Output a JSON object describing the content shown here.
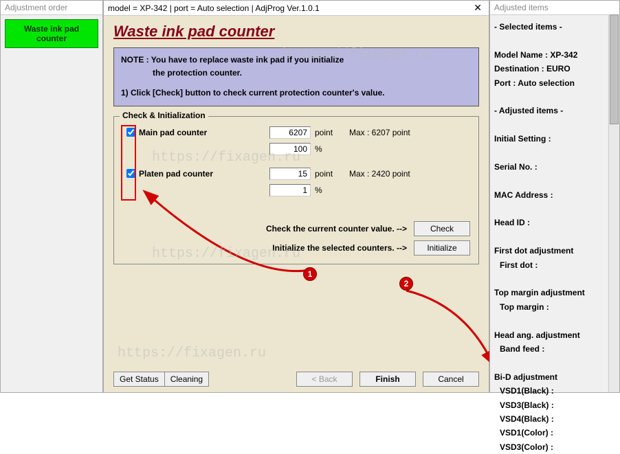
{
  "left": {
    "title": "Adjustment order",
    "button": "Waste ink pad counter"
  },
  "center": {
    "header": "model = XP-342 | port = Auto selection | AdjProg Ver.1.0.1",
    "close": "✕",
    "heading": "Waste ink pad counter",
    "note_l1": "NOTE : You have to replace waste ink pad if you initialize",
    "note_l2": "the protection counter.",
    "note_l3": "1) Click [Check] button to check current protection counter's value.",
    "fieldset_legend": "Check & Initialization",
    "main_pad": {
      "label": "Main pad counter",
      "value": "6207",
      "unit": "point",
      "max": "Max : 6207 point",
      "pct": "100",
      "pct_unit": "%"
    },
    "platen_pad": {
      "label": "Platen pad counter",
      "value": "15",
      "unit": "point",
      "max": "Max : 2420 point",
      "pct": "1",
      "pct_unit": "%"
    },
    "check_text": "Check the current counter value. -->",
    "init_text": "Initialize the selected counters. -->",
    "check_btn": "Check",
    "init_btn": "Initialize",
    "get_status": "Get Status",
    "cleaning": "Cleaning",
    "back": "< Back",
    "finish": "Finish",
    "cancel": "Cancel"
  },
  "right": {
    "title": "Adjusted items",
    "h1": "- Selected items -",
    "model": "Model Name : XP-342",
    "dest": "Destination : EURO",
    "port": "Port : Auto selection",
    "h2": "- Adjusted items -",
    "initial": "Initial Setting :",
    "serial": "Serial No. :",
    "mac": "MAC Address :",
    "head": "Head ID :",
    "fda": "First dot adjustment",
    "fda2": "First dot :",
    "tma": "Top margin adjustment",
    "tma2": "Top margin :",
    "haa": "Head ang. adjustment",
    "haa2": "Band feed :",
    "bid": "Bi-D adjustment",
    "v1": "VSD1(Black) :",
    "v2": "VSD3(Black) :",
    "v3": "VSD4(Black) :",
    "v4": "VSD1(Color) :",
    "v5": "VSD3(Color) :"
  },
  "watermarks": [
    "https://fixagen.ru",
    "https://fixagen.ru",
    "https://fixagen.ru",
    "https://fixagen.ru"
  ]
}
